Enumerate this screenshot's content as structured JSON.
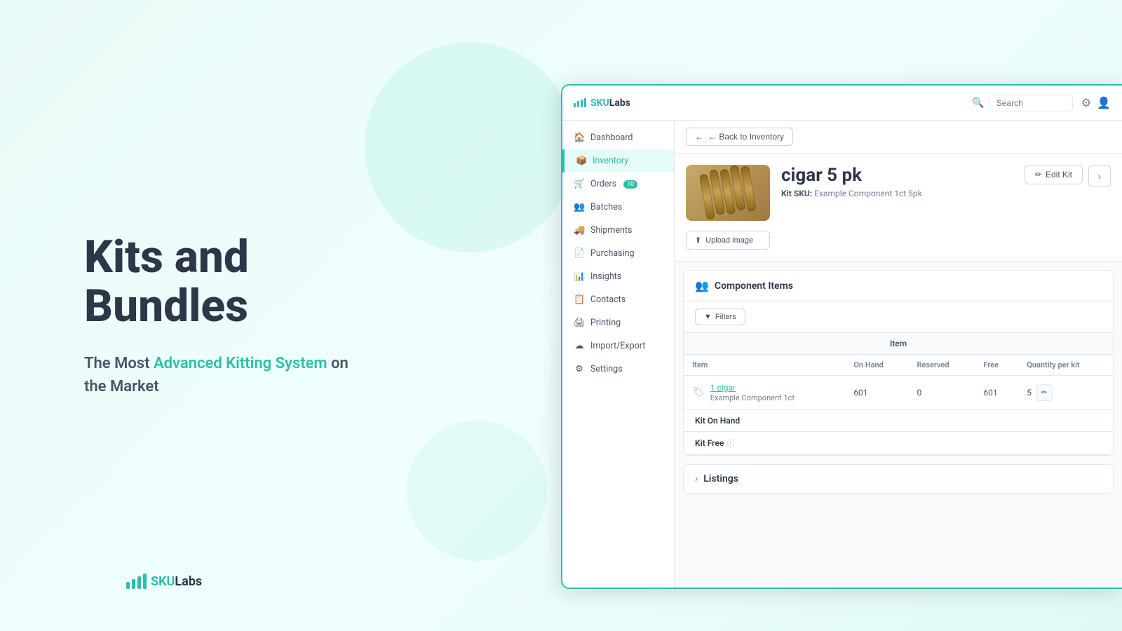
{
  "background": {
    "gradient_start": "#e8faf7",
    "gradient_end": "#e0f9f4"
  },
  "left_panel": {
    "heading_line1": "Kits and Bundles",
    "subtitle_part1": "The Most ",
    "subtitle_highlight": "Advanced Kitting System",
    "subtitle_part2": " on",
    "subtitle_line2": "the Market",
    "brand_name_prefix": "SKU",
    "brand_name_suffix": "Labs"
  },
  "app": {
    "topbar": {
      "logo": "SKULabs",
      "logo_sku": "SKU",
      "logo_labs": "Labs",
      "search_placeholder": "Search",
      "gear_icon": "⚙",
      "user_icon": "👤"
    },
    "sidebar": {
      "items": [
        {
          "id": "dashboard",
          "label": "Dashboard",
          "icon": "🏠",
          "active": false,
          "badge": null
        },
        {
          "id": "inventory",
          "label": "Inventory",
          "icon": "📦",
          "active": true,
          "badge": null
        },
        {
          "id": "orders",
          "label": "Orders",
          "icon": "🛒",
          "active": false,
          "badge": "10"
        },
        {
          "id": "batches",
          "label": "Batches",
          "icon": "👥",
          "active": false,
          "badge": null
        },
        {
          "id": "shipments",
          "label": "Shipments",
          "icon": "🚚",
          "active": false,
          "badge": null
        },
        {
          "id": "purchasing",
          "label": "Purchasing",
          "icon": "📄",
          "active": false,
          "badge": null
        },
        {
          "id": "insights",
          "label": "Insights",
          "icon": "📊",
          "active": false,
          "badge": null
        },
        {
          "id": "contacts",
          "label": "Contacts",
          "icon": "📋",
          "active": false,
          "badge": null
        },
        {
          "id": "printing",
          "label": "Printing",
          "icon": "🖨",
          "active": false,
          "badge": null
        },
        {
          "id": "import_export",
          "label": "Import/Export",
          "icon": "☁",
          "active": false,
          "badge": null
        },
        {
          "id": "settings",
          "label": "Settings",
          "icon": "⚙",
          "active": false,
          "badge": null
        }
      ]
    },
    "content": {
      "back_btn": "← Back to Inventory",
      "product_name": "cigar 5 pk",
      "product_sku_label": "Kit SKU:",
      "product_sku_value": "Example Component 1ct 5pk",
      "upload_btn": "Upload image",
      "edit_kit_btn": "Edit Kit",
      "component_items_title": "Component Items",
      "filters_btn": "Filters",
      "table_group_header": "Item",
      "table_columns": [
        {
          "id": "item",
          "label": "Item"
        },
        {
          "id": "on_hand",
          "label": "On Hand"
        },
        {
          "id": "reserved",
          "label": "Reserved"
        },
        {
          "id": "free",
          "label": "Free"
        },
        {
          "id": "qty_per_kit",
          "label": "Quantity per kit"
        }
      ],
      "table_rows": [
        {
          "item_name": "1 cigar",
          "item_sub": "Example Component 1ct",
          "on_hand": "601",
          "reserved": "0",
          "free": "601",
          "qty_per_kit": "5"
        }
      ],
      "kit_on_hand_label": "Kit On Hand",
      "kit_free_label": "Kit Free",
      "info_icon": "ⓘ",
      "listings_title": "Listings",
      "chevron_icon": "›"
    }
  }
}
